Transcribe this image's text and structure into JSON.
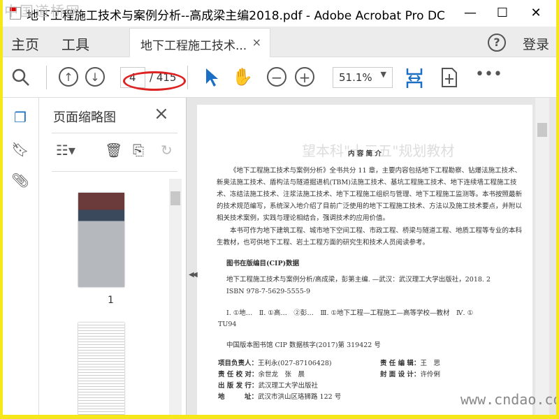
{
  "watermark": "中国道桥网",
  "window": {
    "title": "地下工程施工技术与案例分析--高成梁主编2018.pdf - Adobe Acrobat Pro DC",
    "minimize": "—",
    "maximize": "☐",
    "close": "✕"
  },
  "menu": {
    "home": "主页",
    "tools": "工具",
    "tab_label": "地下工程施工技术...",
    "tab_close": "×",
    "help": "?",
    "login": "登录"
  },
  "toolbar": {
    "current_page": "4",
    "total_pages": "/ 415",
    "zoom": "51.1%"
  },
  "panel": {
    "title": "页面缩略图",
    "thumbs": [
      {
        "label": "1"
      }
    ]
  },
  "doc": {
    "heading": "内 容 简 介",
    "intro1": "《地下工程施工技术与案例分析》全书共分 11 章，主要内容包括地下工程勘察、钻爆法施工技术、新奥法施工技术、盾构法与隧道掘进机(TBM)法施工技术、基坑工程施工技术、地下连续墙工程施工技术、冻结法施工技术、注浆法施工技术、地下工程施工组织与管理、地下工程施工监测等。本书按照最新的技术规范编写，系统深入地介绍了目前广泛使用的地下工程施工技术、方法以及施工技术要点，并附以相关技术案例，实践与理论相结合，强调技术的应用价值。",
    "intro2": "本书可作为地下建筑工程、城市地下空间工程、市政工程、桥梁与隧道工程、地质工程等专业的本科生教材，也可供地下工程、岩土工程方面的研究生和技术人员阅读参考。",
    "cip_title": "图书在版编目(CIP)数据",
    "cip_line1": "地下工程施工技术与案例分析/高成梁，彭第主编. —武汉：武汉理工大学出版社，2018. 2",
    "cip_isbn": "ISBN 978-7-5629-5555-9",
    "cip_class": "Ⅰ. ①地…　Ⅱ. ①高…　②彭…　Ⅲ. ①地下工程—工程施工—高等学校—教材　Ⅳ. ①",
    "cip_tu": "TU94",
    "cip_no": "中国版本图书馆 CIP 数据核字(2017)第 319422 号",
    "credits": [
      {
        "k": "项目负责人：",
        "v": "王利永(027-87106428)"
      },
      {
        "k": "责 任 编 辑：",
        "v": "王　思"
      },
      {
        "k": "责 任 校 对：",
        "v": "余世龙　张　晨"
      },
      {
        "k": "封 面 设 计：",
        "v": "许伶俐"
      },
      {
        "k": "出 版 发 行：",
        "v": "武汉理工大学出版社"
      },
      {
        "k": "地　　　址：",
        "v": "武汉市洪山区珞狮路 122 号"
      }
    ]
  },
  "site_watermark": "www.cndao.com"
}
